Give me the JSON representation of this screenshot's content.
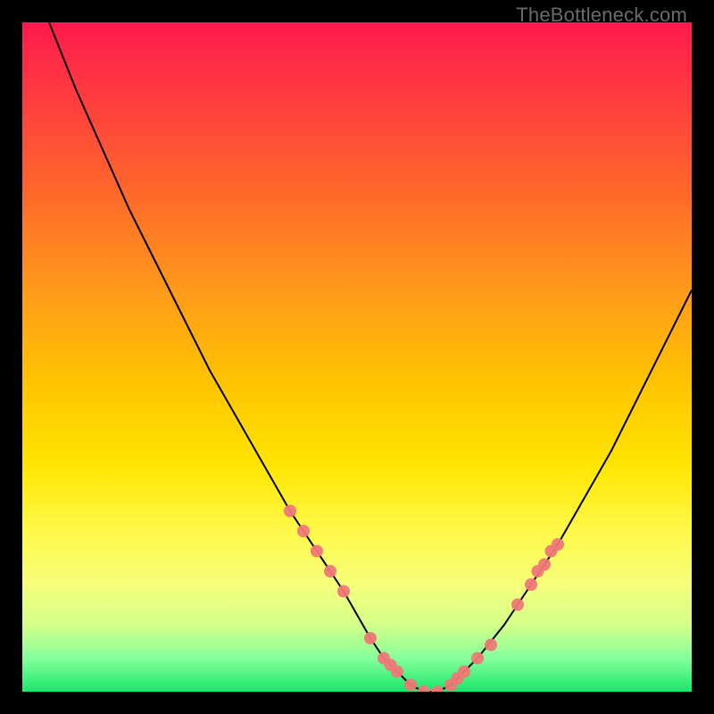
{
  "watermark": "TheBottleneck.com",
  "chart_data": {
    "type": "line",
    "title": "",
    "xlabel": "",
    "ylabel": "",
    "xlim": [
      0,
      100
    ],
    "ylim": [
      0,
      100
    ],
    "x": [
      4,
      8,
      12,
      16,
      20,
      24,
      28,
      32,
      36,
      40,
      44,
      48,
      52,
      54,
      56,
      58,
      60,
      62,
      64,
      66,
      68,
      72,
      76,
      80,
      84,
      88,
      92,
      96,
      100
    ],
    "values": [
      100,
      90,
      81,
      72,
      64,
      56,
      48,
      41,
      34,
      27,
      21,
      15,
      8,
      5,
      3,
      1,
      0,
      0,
      1,
      3,
      5,
      10,
      16,
      22,
      29,
      36,
      44,
      52,
      60
    ],
    "marker_points_x": [
      40,
      42,
      44,
      46,
      48,
      52,
      54,
      55,
      56,
      58,
      60,
      62,
      64,
      65,
      66,
      68,
      70,
      74,
      76,
      77,
      78,
      79,
      80
    ],
    "marker_points_y": [
      27,
      24,
      21,
      18,
      15,
      8,
      5,
      4,
      3,
      1,
      0,
      0,
      1,
      2,
      3,
      5,
      7,
      13,
      16,
      18,
      19,
      21,
      22
    ]
  }
}
